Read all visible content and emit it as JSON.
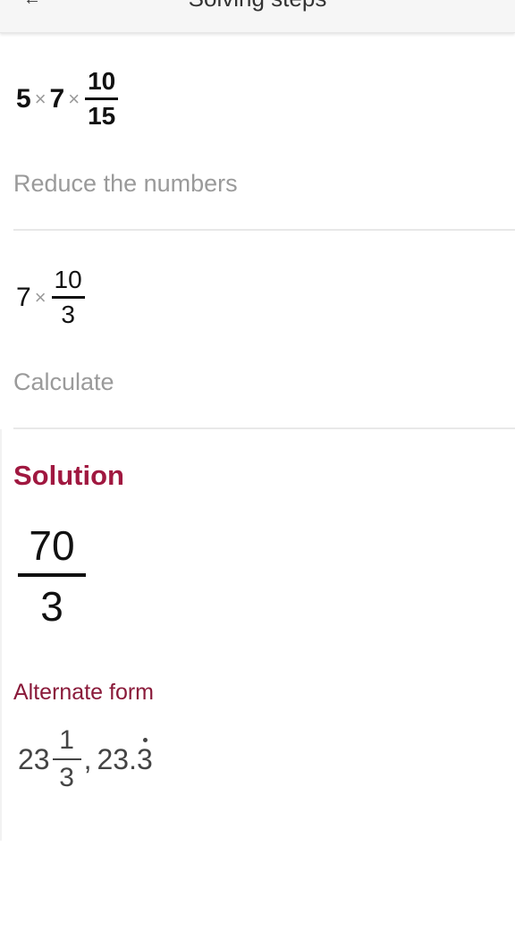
{
  "header": {
    "title": "Solving steps",
    "back_icon": "arrow-left-icon"
  },
  "steps": [
    {
      "expression": {
        "factors": [
          "5",
          "7"
        ],
        "operator": "×",
        "fraction": {
          "numerator": "10",
          "denominator": "15"
        }
      },
      "caption": "Reduce the numbers"
    },
    {
      "expression": {
        "factors": [
          "7"
        ],
        "operator": "×",
        "fraction": {
          "numerator": "10",
          "denominator": "3"
        }
      },
      "caption": "Calculate"
    }
  ],
  "solution": {
    "label": "Solution",
    "fraction": {
      "numerator": "70",
      "denominator": "3"
    },
    "color": "#a01840"
  },
  "alternate_form": {
    "label": "Alternate form",
    "mixed": {
      "whole": "23",
      "numerator": "1",
      "denominator": "3"
    },
    "separator": ",",
    "decimal": {
      "prefix": "23.",
      "repeating": "3"
    }
  }
}
